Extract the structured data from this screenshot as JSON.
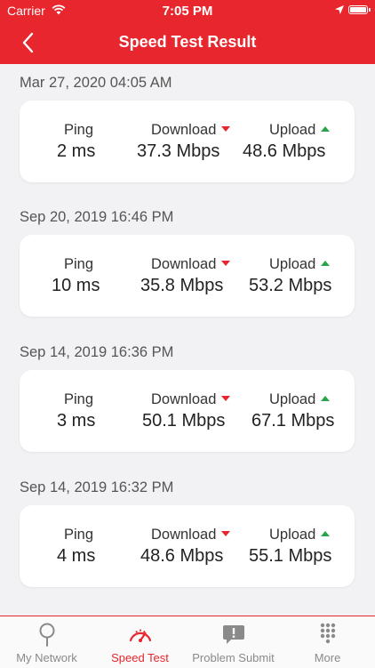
{
  "status_bar": {
    "carrier": "Carrier",
    "time": "7:05 PM"
  },
  "header": {
    "title": "Speed Test Result",
    "back_icon": "chevron-left-icon"
  },
  "labels": {
    "ping": "Ping",
    "download": "Download",
    "upload": "Upload"
  },
  "results": [
    {
      "date": "Mar 27, 2020 04:05 AM",
      "ping": "2 ms",
      "download": "37.3 Mbps",
      "upload": "48.6 Mbps"
    },
    {
      "date": "Sep 20, 2019 16:46 PM",
      "ping": "10 ms",
      "download": "35.8 Mbps",
      "upload": "53.2 Mbps"
    },
    {
      "date": "Sep 14, 2019 16:36 PM",
      "ping": "3 ms",
      "download": "50.1 Mbps",
      "upload": "67.1 Mbps"
    },
    {
      "date": "Sep 14, 2019 16:32 PM",
      "ping": "4 ms",
      "download": "48.6 Mbps",
      "upload": "55.1 Mbps"
    }
  ],
  "tabs": [
    {
      "label": "My Network",
      "icon": "location-pin-icon",
      "active": false
    },
    {
      "label": "Speed Test",
      "icon": "speedometer-icon",
      "active": true
    },
    {
      "label": "Problem Submit",
      "icon": "alert-message-icon",
      "active": false
    },
    {
      "label": "More",
      "icon": "keypad-grid-icon",
      "active": false
    }
  ],
  "colors": {
    "brand": "#e8262d",
    "download_arrow": "#e8262d",
    "upload_arrow": "#2aa44a",
    "inactive_tab": "#8a8a8a"
  }
}
